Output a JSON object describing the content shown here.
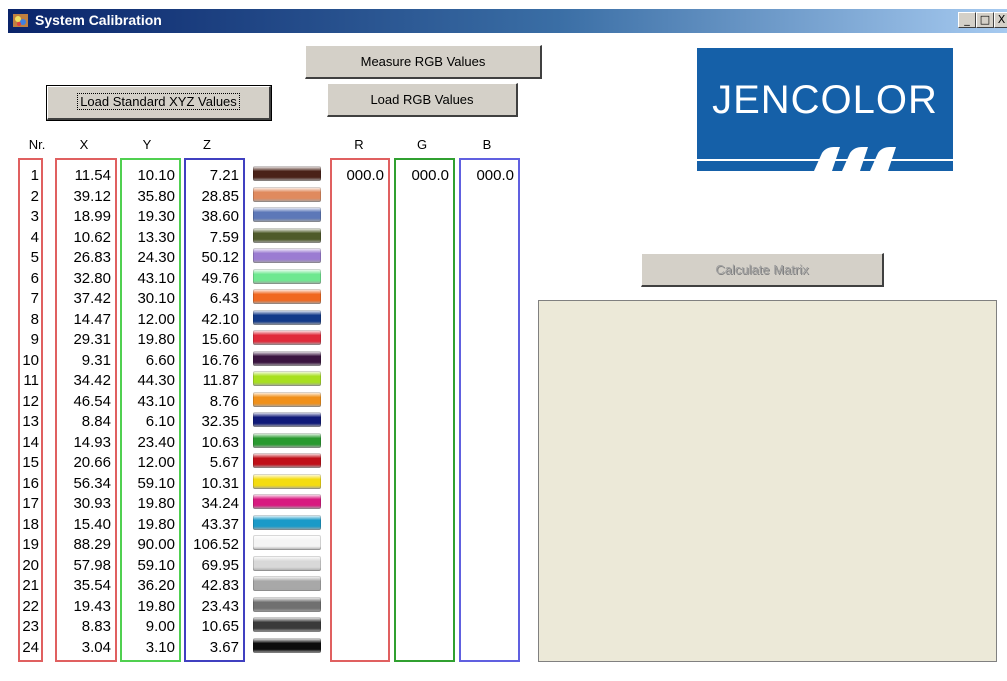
{
  "window": {
    "title": "System Calibration",
    "controls": [
      "_",
      "□",
      "X"
    ]
  },
  "buttons": {
    "load_xyz": "Load Standard XYZ Values",
    "measure_rgb": "Measure RGB Values",
    "load_rgb": "Load RGB Values",
    "calculate": "Calculate Matrix"
  },
  "headers": {
    "nr": "Nr.",
    "x": "X",
    "y": "Y",
    "z": "Z",
    "r": "R",
    "g": "G",
    "b": "B"
  },
  "logo": {
    "text": "JENCOLOR",
    "background": "#1560a8"
  },
  "rows": [
    {
      "nr": "1",
      "x": "11.54",
      "y": "10.10",
      "z": "7.21",
      "color": "#4a2218"
    },
    {
      "nr": "2",
      "x": "39.12",
      "y": "35.80",
      "z": "28.85",
      "color": "#e08a5e"
    },
    {
      "nr": "3",
      "x": "18.99",
      "y": "19.30",
      "z": "38.60",
      "color": "#5d78b8"
    },
    {
      "nr": "4",
      "x": "10.62",
      "y": "13.30",
      "z": "7.59",
      "color": "#4f5a2a"
    },
    {
      "nr": "5",
      "x": "26.83",
      "y": "24.30",
      "z": "50.12",
      "color": "#9b7cd2"
    },
    {
      "nr": "6",
      "x": "32.80",
      "y": "43.10",
      "z": "49.76",
      "color": "#6ee890"
    },
    {
      "nr": "7",
      "x": "37.42",
      "y": "30.10",
      "z": "6.43",
      "color": "#f06820"
    },
    {
      "nr": "8",
      "x": "14.47",
      "y": "12.00",
      "z": "42.10",
      "color": "#123a8a"
    },
    {
      "nr": "9",
      "x": "29.31",
      "y": "19.80",
      "z": "15.60",
      "color": "#e02a3a"
    },
    {
      "nr": "10",
      "x": "9.31",
      "y": "6.60",
      "z": "16.76",
      "color": "#3a1440"
    },
    {
      "nr": "11",
      "x": "34.42",
      "y": "44.30",
      "z": "11.87",
      "color": "#a8e020"
    },
    {
      "nr": "12",
      "x": "46.54",
      "y": "43.10",
      "z": "8.76",
      "color": "#f0901a"
    },
    {
      "nr": "13",
      "x": "8.84",
      "y": "6.10",
      "z": "32.35",
      "color": "#101a7a"
    },
    {
      "nr": "14",
      "x": "14.93",
      "y": "23.40",
      "z": "10.63",
      "color": "#2a9a30"
    },
    {
      "nr": "15",
      "x": "20.66",
      "y": "12.00",
      "z": "5.67",
      "color": "#c01018"
    },
    {
      "nr": "16",
      "x": "56.34",
      "y": "59.10",
      "z": "10.31",
      "color": "#f4dc10"
    },
    {
      "nr": "17",
      "x": "30.93",
      "y": "19.80",
      "z": "34.24",
      "color": "#d81a80"
    },
    {
      "nr": "18",
      "x": "15.40",
      "y": "19.80",
      "z": "43.37",
      "color": "#1a9ac8"
    },
    {
      "nr": "19",
      "x": "88.29",
      "y": "90.00",
      "z": "106.52",
      "color": "#f4f4f4"
    },
    {
      "nr": "20",
      "x": "57.98",
      "y": "59.10",
      "z": "69.95",
      "color": "#d8d8d8"
    },
    {
      "nr": "21",
      "x": "35.54",
      "y": "36.20",
      "z": "42.83",
      "color": "#a8a8a8"
    },
    {
      "nr": "22",
      "x": "19.43",
      "y": "19.80",
      "z": "23.43",
      "color": "#707070"
    },
    {
      "nr": "23",
      "x": "8.83",
      "y": "9.00",
      "z": "10.65",
      "color": "#3a3a3a"
    },
    {
      "nr": "24",
      "x": "3.04",
      "y": "3.10",
      "z": "3.67",
      "color": "#0c0c0c"
    }
  ],
  "rgb": {
    "r": "000.0",
    "g": "000.0",
    "b": "000.0"
  },
  "colors": {
    "x_border": "#e06060",
    "nr_border": "#e06060",
    "y_border": "#50d050",
    "z_border": "#4040c0",
    "r_border": "#e06060",
    "g_border": "#30a030",
    "b_border": "#6060e0"
  }
}
